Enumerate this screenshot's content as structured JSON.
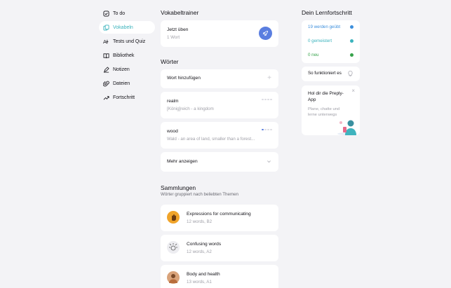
{
  "sidebar": {
    "items": [
      {
        "label": "To do",
        "icon": "checkbox-icon"
      },
      {
        "label": "Vokabeln",
        "icon": "cards-icon",
        "active": true
      },
      {
        "label": "Tests und Quiz",
        "icon": "quiz-icon"
      },
      {
        "label": "Bibliothek",
        "icon": "book-icon"
      },
      {
        "label": "Notizen",
        "icon": "pen-icon"
      },
      {
        "label": "Dateien",
        "icon": "paperclip-icon"
      },
      {
        "label": "Fortschritt",
        "icon": "trend-icon"
      }
    ]
  },
  "trainer": {
    "title": "Vokabeltrainer",
    "practice_title": "Jetzt üben",
    "practice_count": "1 Wort"
  },
  "words": {
    "title": "Wörter",
    "add_label": "Wort hinzufügen",
    "items": [
      {
        "word": "realm",
        "definition": "[König]reich - a kingdom",
        "level": 0
      },
      {
        "word": "wood",
        "definition": "Wald - an area of land, smaller than a forest...",
        "level": 1
      }
    ],
    "more_label": "Mehr anzeigen"
  },
  "collections": {
    "title": "Sammlungen",
    "subtitle": "Wörter gruppiert nach beliebten Themen",
    "items": [
      {
        "name": "Expressions for communicating",
        "meta": "12 words, B2",
        "color": "#f0a42a"
      },
      {
        "name": "Confusing words",
        "meta": "12 words, A2",
        "color": "#e9e9ee"
      },
      {
        "name": "Body and health",
        "meta": "13 words, A1",
        "color": "#d9a37a"
      }
    ]
  },
  "progress": {
    "title": "Dein Lernfortschritt",
    "rows": [
      {
        "label": "19 werden geübt",
        "color": "#3d8fdc"
      },
      {
        "label": "0 gemeistert",
        "color": "#3bb3bd"
      },
      {
        "label": "0 neu",
        "color": "#37a24b"
      }
    ],
    "how_label": "So funktioniert es",
    "app_title": "Hol dir die Preply-App",
    "app_text": "Plane, chatte und lerne unterwegs"
  }
}
